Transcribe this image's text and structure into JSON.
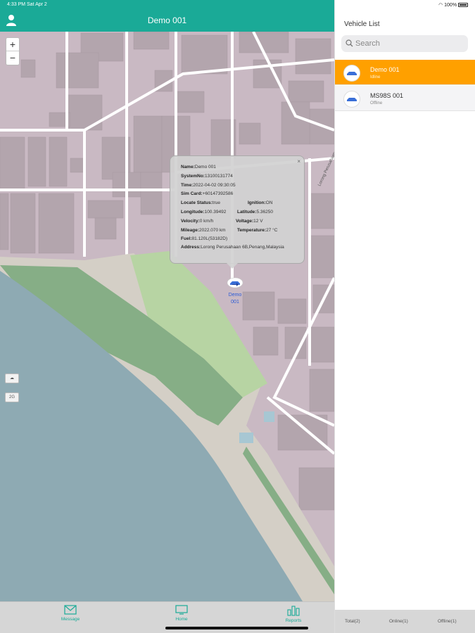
{
  "status_bar": {
    "time_date": "4:33 PM  Sat Apr 2",
    "battery": "100%"
  },
  "header": {
    "title": "Demo 001"
  },
  "map": {
    "zoom_in": "+",
    "zoom_out": "−",
    "layer_button_1": "☁",
    "layer_button_2": "2G",
    "road_label": "Lorong Perusahaan 1",
    "colors": {
      "land": "#c9b9c3",
      "building": "#b3a5ad",
      "sea": "#8eaab3",
      "green": "#86ae86",
      "light_green": "#b7d4a3",
      "road": "#ffffff"
    }
  },
  "popup": {
    "close": "×",
    "rows": [
      {
        "k": "Name:",
        "v": "Demo 001"
      },
      {
        "k": "SystemNo:",
        "v": "13100131774"
      },
      {
        "k": "Time:",
        "v": "2022-04-02 09:30:05"
      },
      {
        "k": "Sim Card:",
        "v": "+60147392586"
      }
    ],
    "pairs": [
      {
        "k1": "Locate Status:",
        "v1": "true",
        "k2": "Ignition:",
        "v2": "ON"
      },
      {
        "k1": "Longitude:",
        "v1": "100.39492",
        "k2": "Latitude:",
        "v2": "5.36250"
      },
      {
        "k1": "Velocity:",
        "v1": "0 km/h",
        "k2": "Voltage:",
        "v2": "12 V"
      },
      {
        "k1": "Mileage:",
        "v1": "2022.070 km",
        "k2": "Temperature:",
        "v2": "27 °C"
      }
    ],
    "fuel": {
      "k": "Fuel:",
      "v": "81.120L(53182D)"
    },
    "address": {
      "k": "Address:",
      "v": "Lorong Perusahaan 6B,Penang,Malaysia"
    }
  },
  "marker": {
    "label": "Demo 001"
  },
  "tabs": [
    {
      "label": "Message",
      "icon": "mail-icon"
    },
    {
      "label": "Home",
      "icon": "monitor-icon"
    },
    {
      "label": "Reports",
      "icon": "bar-chart-icon"
    }
  ],
  "sidebar": {
    "title": "Vehicle List",
    "search_placeholder": "Search",
    "vehicles": [
      {
        "name": "Demo 001",
        "status": "Idline",
        "selected": true
      },
      {
        "name": "MS98S 001",
        "status": "Offline",
        "selected": false
      }
    ],
    "footer": {
      "total": "Total(2)",
      "online": "Online(1)",
      "offline": "Offline(1)"
    },
    "selected_color": "#ffa000"
  },
  "accent_color": "#1aaa97"
}
